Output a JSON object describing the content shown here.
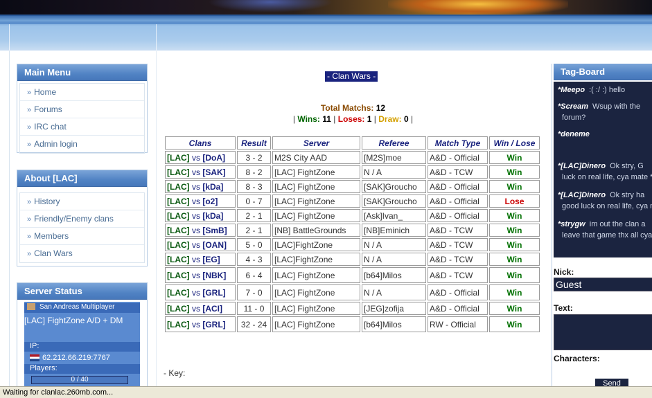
{
  "left": {
    "main_menu": {
      "title": "Main Menu",
      "items": [
        "Home",
        "Forums",
        "IRC chat",
        "Admin login"
      ]
    },
    "about": {
      "title": "About [LAC]",
      "items": [
        "History",
        "Friendly/Enemy clans",
        "Members",
        "Clan Wars"
      ]
    },
    "server_status": {
      "title": "Server Status",
      "game": "San Andreas Multiplayer",
      "name": "[LAC] FightZone A/D + DM",
      "ip_label": "IP:",
      "ip": "62.212.66.219:7767",
      "players_label": "Players:",
      "players": "0 / 40"
    }
  },
  "main": {
    "title": "- Clan Wars -",
    "total_label": "Total Matchs:",
    "total": "12",
    "wins_label": "Wins:",
    "wins": "11",
    "loses_label": "Loses:",
    "loses": "1",
    "draw_label": "Draw:",
    "draw": "0",
    "headers": [
      "Clans",
      "Result",
      "Server",
      "Referee",
      "Match Type",
      "Win / Lose"
    ],
    "vs": "vs",
    "rows": [
      {
        "lac": "[LAC]",
        "opp": "[DoA]",
        "result": "3 - 2",
        "server": "M2S City AAD",
        "referee": "[M2S]moe",
        "type": "A&D - Official",
        "wl": "Win"
      },
      {
        "lac": "[LAC]",
        "opp": "[SAK]",
        "result": "8 - 2",
        "server": "[LAC] FightZone",
        "referee": "N / A",
        "type": "A&D - TCW",
        "wl": "Win"
      },
      {
        "lac": "[LAC]",
        "opp": "[kDa]",
        "result": "8 - 3",
        "server": "[LAC] FightZone",
        "referee": "[SAK]Groucho",
        "type": "A&D - Official",
        "wl": "Win"
      },
      {
        "lac": "[LAC]",
        "opp": "[o2]",
        "result": "0 - 7",
        "server": "[LAC] FightZone",
        "referee": "[SAK]Groucho",
        "type": "A&D - Official",
        "wl": "Lose"
      },
      {
        "lac": "[LAC]",
        "opp": "[kDa]",
        "result": "2 - 1",
        "server": "[LAC] FightZone",
        "referee": "[Ask]Ivan_",
        "type": "A&D - Official",
        "wl": "Win"
      },
      {
        "lac": "[LAC]",
        "opp": "[SmB]",
        "result": "2 - 1",
        "server": "[NB] BattleGrounds",
        "referee": "[NB]Eminich",
        "type": "A&D - TCW",
        "wl": "Win"
      },
      {
        "lac": "[LAC]",
        "opp": "[OAN]",
        "result": "5 - 0",
        "server": "[LAC]FightZone",
        "referee": "N / A",
        "type": "A&D - TCW",
        "wl": "Win"
      },
      {
        "lac": "[LAC]",
        "opp": "[EG]",
        "result": "4 - 3",
        "server": "[LAC]FightZone",
        "referee": "N / A",
        "type": "A&D - TCW",
        "wl": "Win"
      },
      {
        "lac": "[LAC]",
        "opp": "[NBK]",
        "result": "6 - 4",
        "server": "[LAC] FightZone",
        "referee": "[b64]Milos",
        "type": "A&D - TCW",
        "wl": "Win"
      },
      {
        "lac": "[LAC]",
        "opp": "[GRL]",
        "result": "7 - 0",
        "server": "[LAC] FightZone",
        "referee": "N / A",
        "type": "A&D - Official",
        "wl": "Win"
      },
      {
        "lac": "[LAC]",
        "opp": "[ACI]",
        "result": "11 - 0",
        "server": "[LAC] FightZone",
        "referee": "[JEG]zofija",
        "type": "A&D - Official",
        "wl": "Win"
      },
      {
        "lac": "[LAC]",
        "opp": "[GRL]",
        "result": "32 - 24",
        "server": "[LAC] FightZone",
        "referee": "[b64]Milos",
        "type": "RW - Official",
        "wl": "Win"
      }
    ],
    "key_label": "- Key:"
  },
  "tagboard": {
    "title": "Tag-Board",
    "messages": [
      {
        "who": "*Meepo",
        "what": ":( :/ :) hello"
      },
      {
        "who": "*Scream",
        "what": "Wsup with the"
      },
      {
        "who": "",
        "what": "forum?"
      },
      {
        "who": "*deneme",
        "what": ""
      },
      {
        "who": "*[LAC]Dinero",
        "what": "Ok stry, G"
      },
      {
        "who": "",
        "what": "luck on real life, cya mate *"
      },
      {
        "who": "*[LAC]Dinero",
        "what": "Ok stry ha"
      },
      {
        "who": "",
        "what": "good luck on real life, cya ma"
      },
      {
        "who": "*strygw",
        "what": "im out the clan a"
      },
      {
        "who": "",
        "what": "leave that game thx all cya"
      }
    ],
    "nick_label": "Nick:",
    "nick_value": "Guest",
    "text_label": "Text:",
    "chars_label": "Characters:",
    "send_label": "Send"
  },
  "status_bar": "Waiting for clanlac.260mb.com..."
}
